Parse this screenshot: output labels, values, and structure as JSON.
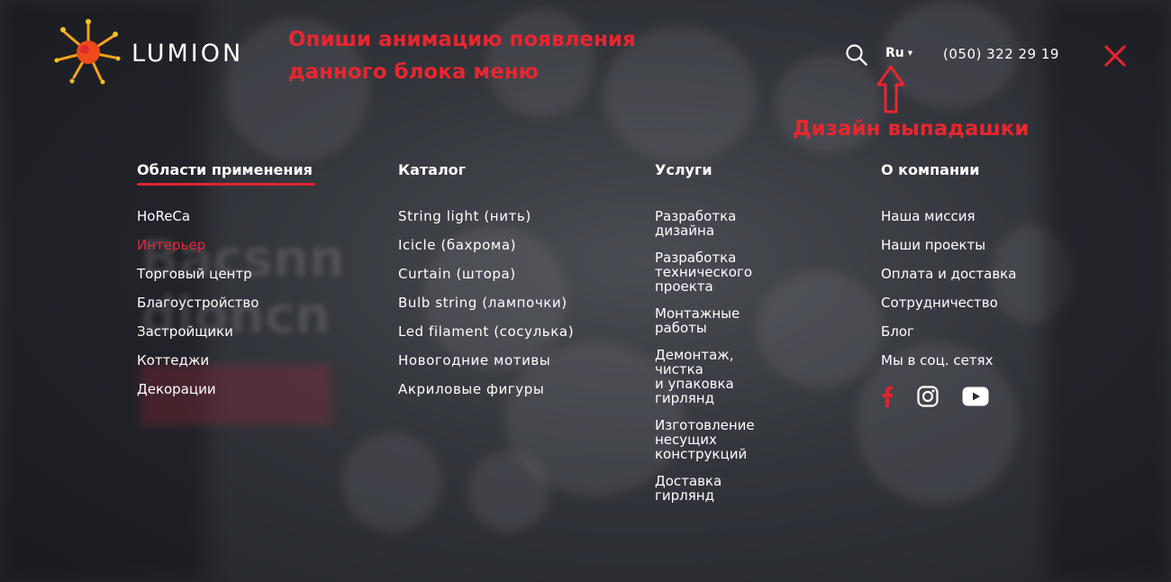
{
  "header": {
    "logo_text": "LUMION",
    "language": "Ru",
    "phone": "(050) 322 29 19"
  },
  "annotations": {
    "menu_animation_note": "Опиши анимацию появления данного блока меню",
    "dropdown_note": "Дизайн выпадашки"
  },
  "menu": {
    "columns": [
      {
        "title": "Области применения",
        "items": [
          "HoReCa",
          "Интерьер",
          "Торговый центр",
          "Благоустройство",
          "Застройщики",
          "Коттеджи",
          "Декорации"
        ]
      },
      {
        "title": "Каталог",
        "items": [
          "String light (нить)",
          "Icicle (бахрома)",
          "Curtain (штора)",
          "Bulb string (лампочки)",
          "Led filament (сосулька)",
          "Новогодние мотивы",
          "Акриловые фигуры"
        ]
      },
      {
        "title": "Услуги",
        "items": [
          "Разработка дизайна",
          "Разработка технического\nпроекта",
          "Монтажные работы",
          "Демонтаж, чистка\nи упаковка гирлянд",
          "Изготовление несущих\nконструкций",
          "Доставка гирлянд"
        ]
      },
      {
        "title": "О компании",
        "items": [
          "Наша миссия",
          "Наши проекты",
          "Оплата и доставка",
          "Сотрудничество",
          "Блог",
          "Мы в соц. сетях"
        ]
      }
    ],
    "active_item": "Интерьер"
  },
  "social": [
    "facebook-icon",
    "instagram-icon",
    "youtube-icon"
  ],
  "colors": {
    "accent": "#e0242f",
    "background": "#2a2c33",
    "text": "#ffffff"
  }
}
